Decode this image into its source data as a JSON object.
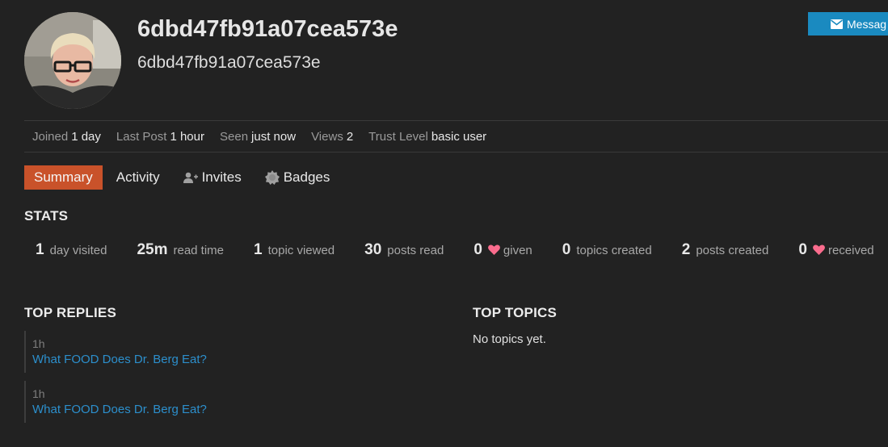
{
  "profile": {
    "username": "6dbd47fb91a07cea573e",
    "name": "6dbd47fb91a07cea573e",
    "message_button": "Messag"
  },
  "meta": [
    {
      "label": "Joined",
      "value": "1 day"
    },
    {
      "label": "Last Post",
      "value": "1 hour"
    },
    {
      "label": "Seen",
      "value": "just now"
    },
    {
      "label": "Views",
      "value": "2"
    },
    {
      "label": "Trust Level",
      "value": "basic user"
    }
  ],
  "nav": {
    "summary": "Summary",
    "activity": "Activity",
    "invites": "Invites",
    "badges": "Badges"
  },
  "stats": {
    "heading": "STATS",
    "items": [
      {
        "num": "1",
        "label": "day visited"
      },
      {
        "num": "25m",
        "label": "read time"
      },
      {
        "num": "1",
        "label": "topic viewed"
      },
      {
        "num": "30",
        "label": "posts read"
      },
      {
        "num": "0",
        "label": "given",
        "icon": "heart-icon"
      },
      {
        "num": "0",
        "label": "topics created"
      },
      {
        "num": "2",
        "label": "posts created"
      },
      {
        "num": "0",
        "label": "received",
        "icon": "heart-icon"
      }
    ]
  },
  "top_replies": {
    "heading": "TOP REPLIES",
    "items": [
      {
        "time": "1h",
        "title": "What FOOD Does Dr. Berg Eat?"
      },
      {
        "time": "1h",
        "title": "What FOOD Does Dr. Berg Eat?"
      }
    ]
  },
  "top_topics": {
    "heading": "TOP TOPICS",
    "empty": "No topics yet."
  },
  "colors": {
    "background": "#222222",
    "accent_active_tab": "#c9522a",
    "message_button": "#1a8ac0",
    "link": "#2c8fcc",
    "heart": "#fa6c8d"
  }
}
